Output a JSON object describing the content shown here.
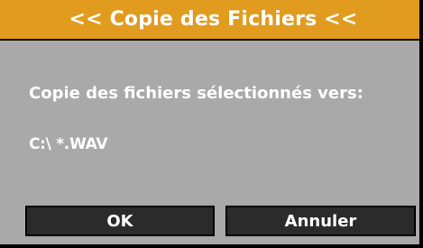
{
  "dialog": {
    "title": "<< Copie des Fichiers <<",
    "message": "Copie des fichiers sélectionnés vers:",
    "destination_path": "C:\\ *.WAV"
  },
  "buttons": {
    "ok_label": "OK",
    "cancel_label": "Annuler"
  },
  "colors": {
    "title_bar": "#e19b1e",
    "dialog_background": "#a9a9a9",
    "button_background": "#2b2b2b",
    "text": "#ffffff"
  }
}
